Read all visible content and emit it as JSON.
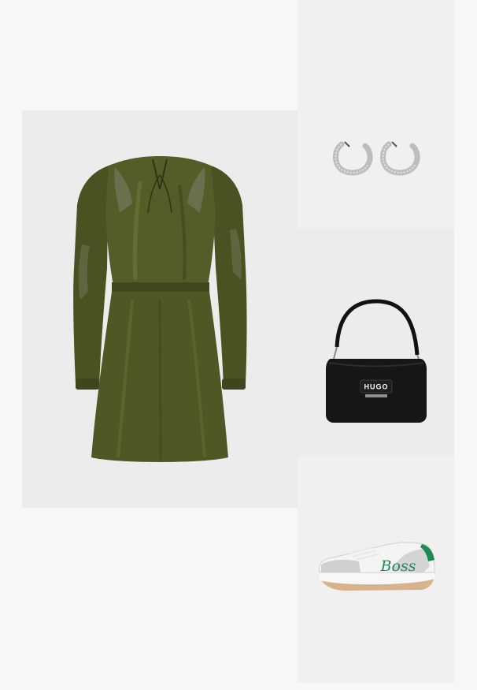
{
  "products": [
    {
      "name": "dress",
      "color": "#4b5221"
    },
    {
      "name": "earrings",
      "color": "#c9c9c9"
    },
    {
      "name": "shoulder-bag",
      "color": "#151515",
      "logo_text": "HUGO"
    },
    {
      "name": "sneaker",
      "color": "#f2f2f2",
      "accent": "#1e8a55",
      "script_text": "Boss"
    }
  ]
}
